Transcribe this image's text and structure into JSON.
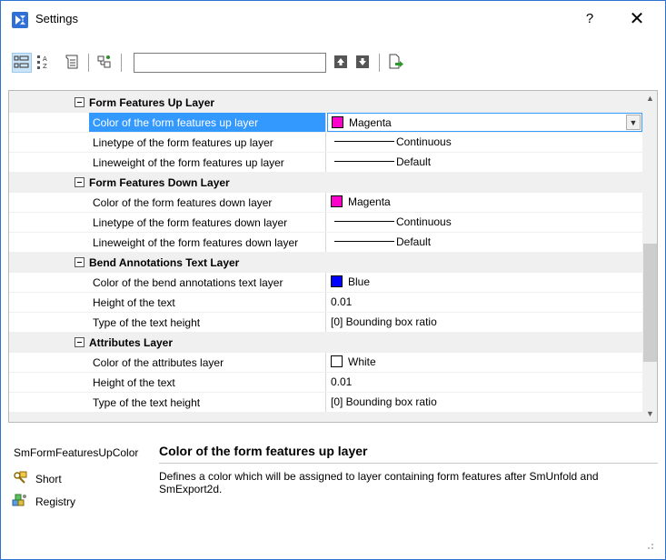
{
  "window": {
    "title": "Settings",
    "help_label": "?",
    "close_label": "✕"
  },
  "toolbar": {
    "search_value": "",
    "icons": [
      "categorized-view-icon",
      "alphabetical-sort-icon",
      "filter-icon",
      "registry-tool-icon",
      "move-up-icon",
      "move-down-icon",
      "export-icon"
    ]
  },
  "grid": {
    "categories": [
      {
        "label": "Form Features Up Layer",
        "rows": [
          {
            "name": "Color of the form features up layer",
            "value": "Magenta",
            "type": "color",
            "swatch": "#ff00cc",
            "selected": true
          },
          {
            "name": "Linetype of the form features up layer",
            "value": "Continuous",
            "type": "line"
          },
          {
            "name": "Lineweight of the form features up layer",
            "value": "Default",
            "type": "line"
          }
        ]
      },
      {
        "label": "Form Features Down Layer",
        "rows": [
          {
            "name": "Color of the form features down layer",
            "value": "Magenta",
            "type": "color",
            "swatch": "#ff00cc"
          },
          {
            "name": "Linetype of the form features down layer",
            "value": "Continuous",
            "type": "line"
          },
          {
            "name": "Lineweight of the form features down layer",
            "value": "Default",
            "type": "line"
          }
        ]
      },
      {
        "label": "Bend Annotations Text Layer",
        "rows": [
          {
            "name": "Color of the bend annotations text layer",
            "value": "Blue",
            "type": "color",
            "swatch": "#0000ff"
          },
          {
            "name": "Height of the text",
            "value": "0.01",
            "type": "text"
          },
          {
            "name": "Type of the text height",
            "value": "[0] Bounding box ratio",
            "type": "text"
          }
        ]
      },
      {
        "label": "Attributes Layer",
        "rows": [
          {
            "name": "Color of the attributes layer",
            "value": "White",
            "type": "color",
            "swatch": "#ffffff"
          },
          {
            "name": "Height of the text",
            "value": "0.01",
            "type": "text"
          },
          {
            "name": "Type of the text height",
            "value": "[0] Bounding box ratio",
            "type": "text"
          }
        ]
      }
    ]
  },
  "description": {
    "key": "SmFormFeaturesUpColor",
    "title": "Color of the form features up layer",
    "text": "Defines a color which will be assigned to layer containing form features after SmUnfold and SmExport2d.",
    "items": [
      {
        "label": "Short",
        "icon": "short-icon"
      },
      {
        "label": "Registry",
        "icon": "registry-icon"
      }
    ]
  }
}
